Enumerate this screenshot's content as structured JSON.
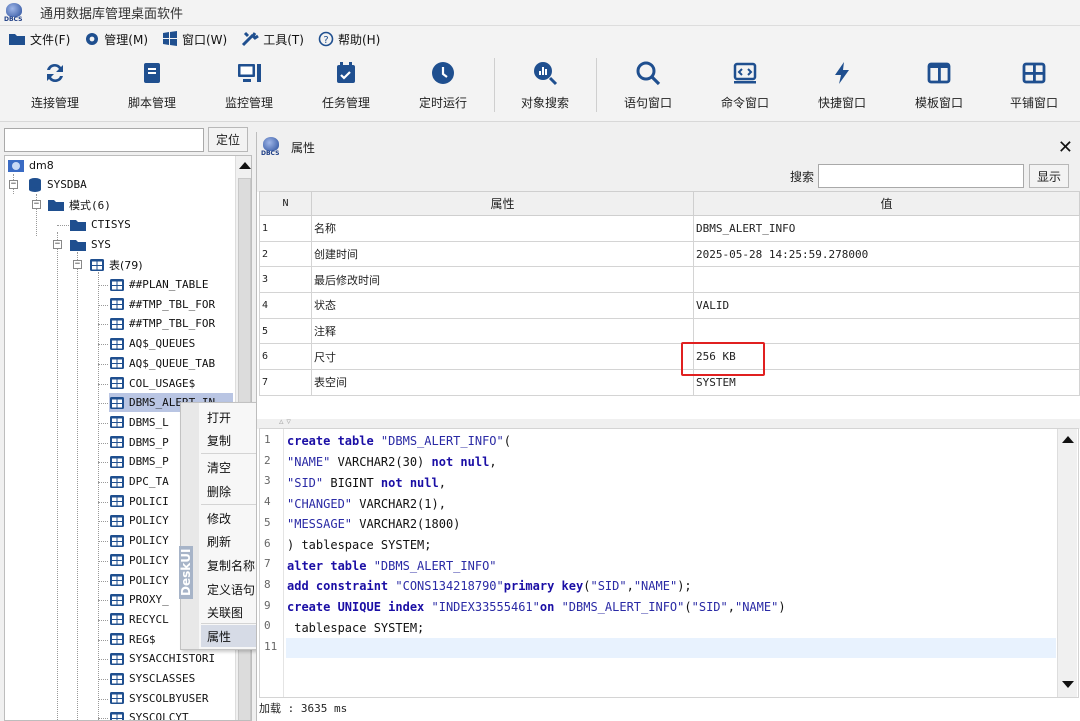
{
  "app": {
    "title": "通用数据库管理桌面软件",
    "logo_text": "DBCS"
  },
  "menu": [
    {
      "label": "文件(F)",
      "icon": "folder-icon"
    },
    {
      "label": "管理(M)",
      "icon": "gear-icon"
    },
    {
      "label": "窗口(W)",
      "icon": "windows-icon"
    },
    {
      "label": "工具(T)",
      "icon": "tools-icon"
    },
    {
      "label": "帮助(H)",
      "icon": "help-icon"
    }
  ],
  "toolbar": [
    {
      "label": "连接管理",
      "icon": "sync-icon"
    },
    {
      "label": "脚本管理",
      "icon": "book-icon"
    },
    {
      "label": "监控管理",
      "icon": "monitor-icon"
    },
    {
      "label": "任务管理",
      "icon": "calendar-check-icon"
    },
    {
      "label": "定时运行",
      "icon": "clock-icon"
    },
    {
      "label": "对象搜索",
      "icon": "chart-search-icon"
    },
    {
      "label": "语句窗口",
      "icon": "search-icon"
    },
    {
      "label": "命令窗口",
      "icon": "terminal-icon"
    },
    {
      "label": "快捷窗口",
      "icon": "bolt-icon"
    },
    {
      "label": "模板窗口",
      "icon": "columns-icon"
    },
    {
      "label": "平铺窗口",
      "icon": "grid-icon"
    }
  ],
  "left": {
    "search_placeholder": "",
    "locate_label": "定位",
    "tree": {
      "root": "dm8",
      "db": "SYSDBA",
      "schemas": "模式(6)",
      "schema1": "CTISYS",
      "schema2": "SYS",
      "tables_node": "表(79)",
      "tables": [
        "##PLAN_TABLE",
        "##TMP_TBL_FOR",
        "##TMP_TBL_FOR",
        "AQ$_QUEUES",
        "AQ$_QUEUE_TAB",
        "COL_USAGE$",
        "DBMS_ALERT_IN",
        "DBMS_L",
        "DBMS_P",
        "DBMS_P",
        "DPC_TA",
        "POLICI",
        "POLICY",
        "POLICY",
        "POLICY",
        "POLICY",
        "PROXY_",
        "RECYCL",
        "REG$",
        "SYSACCHISTORI",
        "SYSCLASSES",
        "SYSCOLBYUSER",
        "SYSCOLCYT"
      ]
    }
  },
  "context_menu": {
    "items": [
      "打开",
      "复制",
      "清空",
      "删除",
      "修改",
      "刷新",
      "复制名称",
      "定义语句",
      "关联图",
      "属性"
    ],
    "watermark": "DeskUI"
  },
  "panel": {
    "title": "属性",
    "search_label": "搜索",
    "search_value": "",
    "show_label": "显示",
    "columns": [
      "N",
      "属性",
      "值"
    ],
    "rows": [
      {
        "n": "1",
        "attr": "名称",
        "value": "DBMS_ALERT_INFO"
      },
      {
        "n": "2",
        "attr": "创建时间",
        "value": "2025-05-28 14:25:59.278000"
      },
      {
        "n": "3",
        "attr": "最后修改时间",
        "value": ""
      },
      {
        "n": "4",
        "attr": "状态",
        "value": "VALID"
      },
      {
        "n": "5",
        "attr": "注释",
        "value": ""
      },
      {
        "n": "6",
        "attr": "尺寸",
        "value": "256 KB"
      },
      {
        "n": "7",
        "attr": "表空间",
        "value": "SYSTEM"
      }
    ],
    "highlight_color": "#e02020"
  },
  "editor": {
    "line_numbers": [
      "1",
      "2",
      "3",
      "4",
      "5",
      "6",
      "7",
      "8",
      "9",
      "0",
      "11"
    ],
    "status": "加载 : 3635 ms"
  }
}
